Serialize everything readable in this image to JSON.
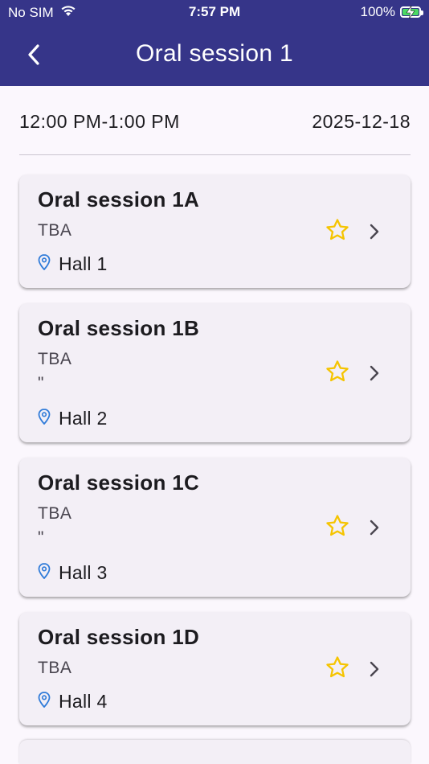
{
  "status_bar": {
    "carrier": "No SIM",
    "time": "7:57 PM",
    "battery": "100%",
    "battery_level": 1.0,
    "wifi_icon": "wifi-icon",
    "battery_icon": "battery-charging-icon"
  },
  "nav": {
    "title": "Oral session 1",
    "back_icon": "back-chevron-icon"
  },
  "session_info": {
    "time_range": "12:00 PM-1:00 PM",
    "date": "2025-12-18"
  },
  "colors": {
    "header_bg": "#363589",
    "background": "#fbf7fd",
    "card_bg": "#f3eff6",
    "star": "#f5c400",
    "location_icon": "#2f7bd9"
  },
  "sessions": [
    {
      "title": "Oral session 1A",
      "speaker": "TBA",
      "extra": "",
      "location": "Hall 1",
      "favorite_icon": "star-outline-icon",
      "favorited": false
    },
    {
      "title": "Oral session 1B",
      "speaker": "TBA",
      "extra": "\"",
      "location": "Hall 2",
      "favorite_icon": "star-outline-icon",
      "favorited": false
    },
    {
      "title": "Oral session 1C",
      "speaker": "TBA",
      "extra": "\"",
      "location": "Hall 3",
      "favorite_icon": "star-outline-icon",
      "favorited": false
    },
    {
      "title": "Oral session 1D",
      "speaker": "TBA",
      "extra": "",
      "location": "Hall 4",
      "favorite_icon": "star-outline-icon",
      "favorited": false
    }
  ]
}
